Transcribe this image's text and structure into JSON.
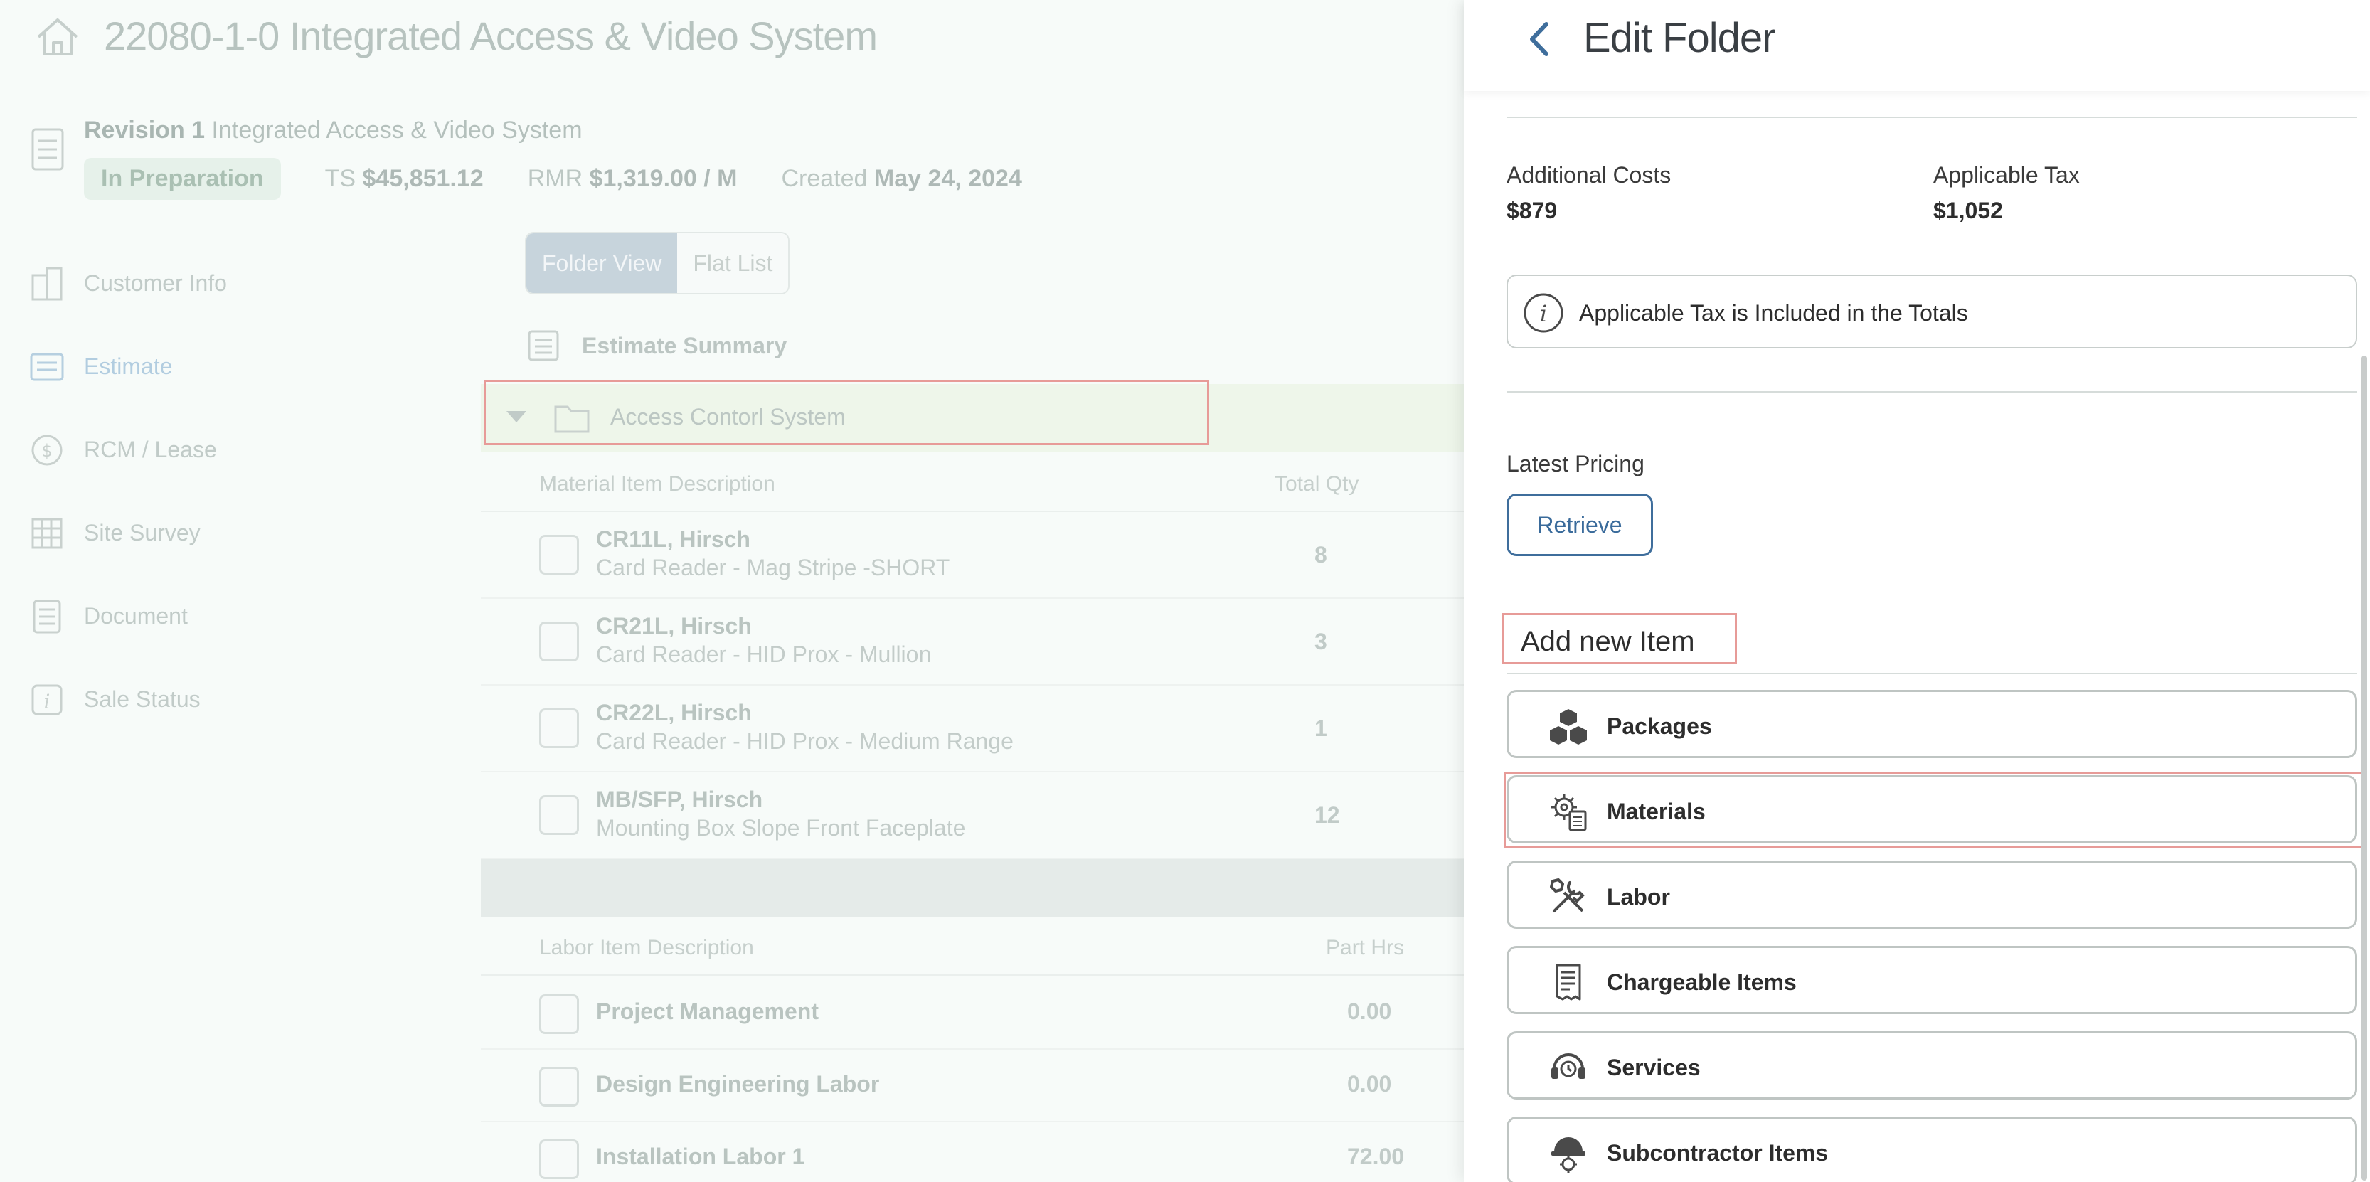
{
  "app": {
    "title": "22080-1-0 Integrated Access & Video System",
    "revision_label": "Revision 1",
    "revision_name": "Integrated Access & Video System",
    "status": "In Preparation",
    "ts_label": "TS",
    "ts_value": "$45,851.12",
    "rmr_label": "RMR",
    "rmr_value": "$1,319.00 / M",
    "created_label": "Created",
    "created_value": "May 24, 2024"
  },
  "sidebar": {
    "items": [
      {
        "label": "Customer Info",
        "icon": "building-icon"
      },
      {
        "label": "Estimate",
        "icon": "estimate-icon",
        "active": true
      },
      {
        "label": "RCM / Lease",
        "icon": "dollar-cycle-icon"
      },
      {
        "label": "Site Survey",
        "icon": "grid-icon"
      },
      {
        "label": "Document",
        "icon": "document-icon"
      },
      {
        "label": "Sale Status",
        "icon": "info-icon"
      }
    ]
  },
  "view_toggle": {
    "folder_view": "Folder View",
    "flat_list": "Flat List"
  },
  "estimate_summary": "Estimate Summary",
  "folder": {
    "name": "Access Contorl System"
  },
  "materials_table": {
    "headers": {
      "description": "Material Item Description",
      "qty": "Total Qty"
    },
    "rows": [
      {
        "name": "CR11L, Hirsch",
        "desc": "Card Reader - Mag Stripe -SHORT",
        "qty": "8"
      },
      {
        "name": "CR21L, Hirsch",
        "desc": "Card Reader - HID Prox - Mullion",
        "qty": "3"
      },
      {
        "name": "CR22L, Hirsch",
        "desc": "Card Reader - HID Prox - Medium Range",
        "qty": "1"
      },
      {
        "name": "MB/SFP, Hirsch",
        "desc": "Mounting Box Slope Front Faceplate",
        "qty": "12"
      }
    ]
  },
  "labor_table": {
    "headers": {
      "description": "Labor Item Description",
      "hrs": "Part Hrs"
    },
    "rows": [
      {
        "name": "Project Management",
        "hrs": "0.00"
      },
      {
        "name": "Design Engineering Labor",
        "hrs": "0.00"
      },
      {
        "name": "Installation Labor 1",
        "hrs": "72.00"
      }
    ]
  },
  "panel": {
    "title": "Edit Folder",
    "additional_costs_label": "Additional Costs",
    "additional_costs_value": "$879",
    "applicable_tax_label": "Applicable Tax",
    "applicable_tax_value": "$1,052",
    "tax_note": "Applicable Tax is Included in the Totals",
    "latest_pricing_label": "Latest Pricing",
    "retrieve_label": "Retrieve",
    "add_new_label": "Add new Item",
    "add_items": [
      {
        "label": "Packages",
        "icon": "boxes-icon"
      },
      {
        "label": "Materials",
        "icon": "gear-document-icon"
      },
      {
        "label": "Labor",
        "icon": "tools-icon"
      },
      {
        "label": "Chargeable Items",
        "icon": "receipt-icon"
      },
      {
        "label": "Services",
        "icon": "headset-icon"
      },
      {
        "label": "Subcontractor Items",
        "icon": "hardhat-icon"
      }
    ]
  },
  "colors": {
    "accent": "#3f6e9c",
    "highlight_box": "#e79b98",
    "overlay_bg": "#eef4f1"
  }
}
